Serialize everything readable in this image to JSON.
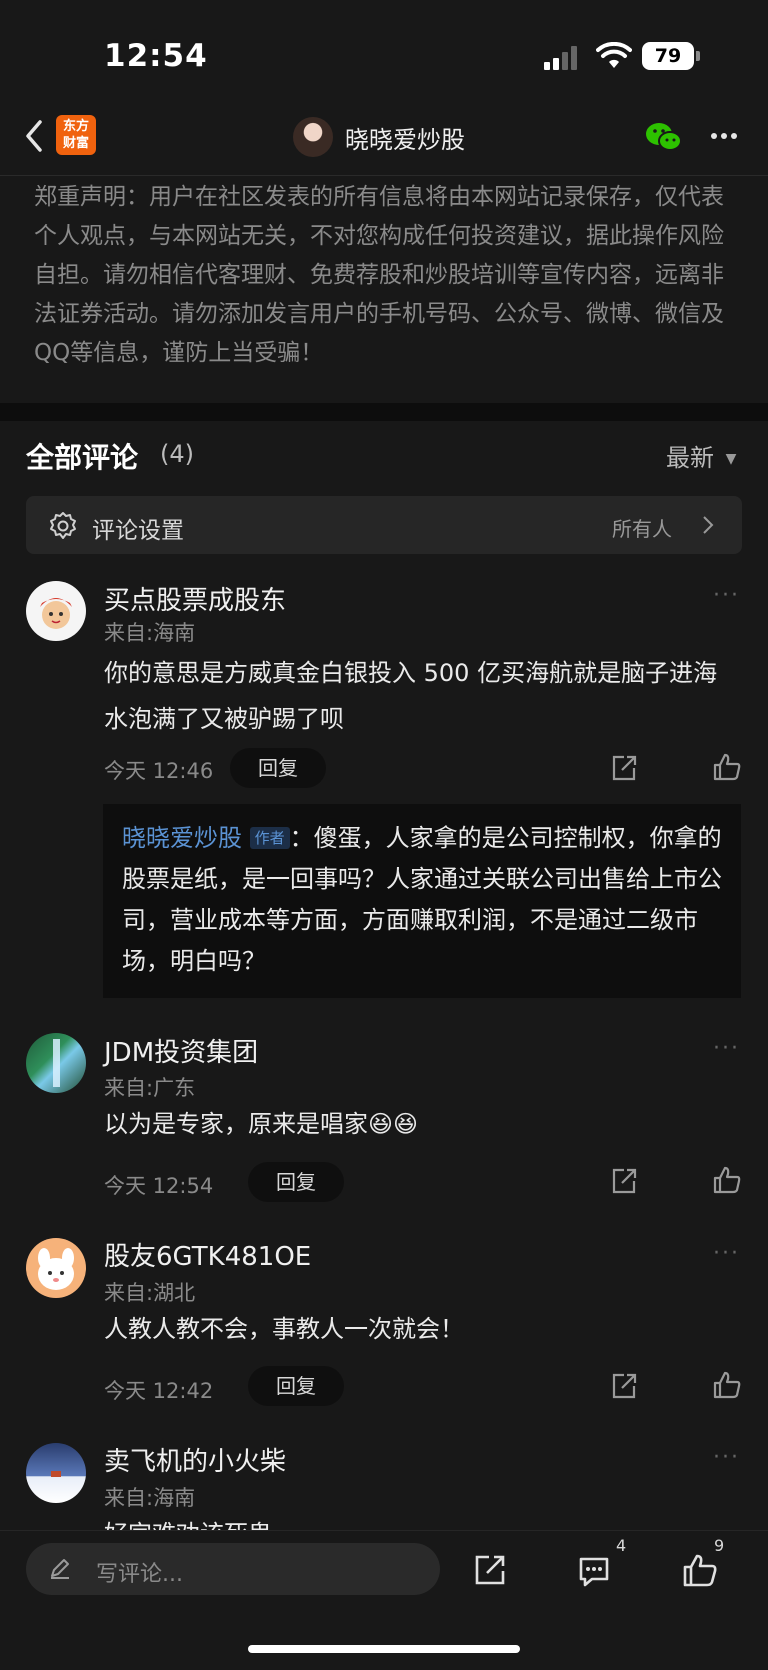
{
  "status_bar": {
    "time": "12:54",
    "battery": "79"
  },
  "nav": {
    "logo_line1": "东方",
    "logo_line2": "财富",
    "title": "晓晓爱炒股"
  },
  "disclaimer": "郑重声明：用户在社区发表的所有信息将由本网站记录保存，仅代表个人观点，与本网站无关，不对您构成任何投资建议，据此操作风险自担。请勿相信代客理财、免费荐股和炒股培训等宣传内容，远离非法证券活动。请勿添加发言用户的手机号码、公众号、微博、微信及QQ等信息，谨防上当受骗！",
  "comments_header": {
    "title": "全部评论",
    "count": "(4)",
    "sort": "最新"
  },
  "settings": {
    "label": "评论设置",
    "value": "所有人"
  },
  "comments": [
    {
      "name": "买点股票成股东",
      "location": "来自:海南",
      "text": "你的意思是方威真金白银投入 500 亿买海航就是脑子进海水泡满了又被驴踢了呗",
      "time": "今天 12:46",
      "reply_label": "回复"
    },
    {
      "name": "JDM投资集团",
      "location": "来自:广东",
      "text": "以为是专家，原来是唱家😆😆",
      "time": "今天 12:54",
      "reply_label": "回复"
    },
    {
      "name": "股友6GTK481OE",
      "location": "来自:湖北",
      "text": "人教人教不会，事教人一次就会！",
      "time": "今天 12:42",
      "reply_label": "回复"
    },
    {
      "name": "卖飞机的小火柴",
      "location": "来自:海南",
      "text": "好宫难劝该死鬼"
    }
  ],
  "author_reply": {
    "name": "晓晓爱炒股",
    "tag": "作者",
    "colon": "：",
    "text": "傻蛋，人家拿的是公司控制权，你拿的股票是纸，是一回事吗？人家通过关联公司出售给上市公司，营业成本等方面，方面赚取利润，不是通过二级市场，明白吗？"
  },
  "bottom_bar": {
    "placeholder": "写评论...",
    "comment_count": "4",
    "like_count": "9"
  }
}
